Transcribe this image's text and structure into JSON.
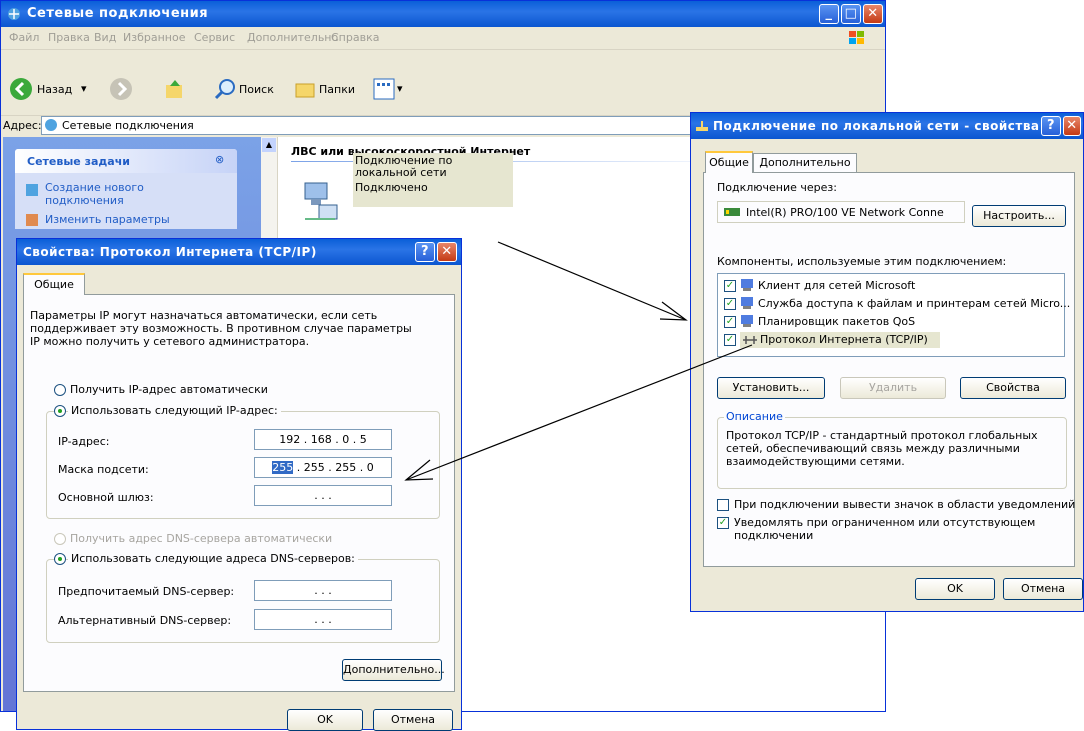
{
  "main": {
    "title": "Сетевые подключения",
    "menu": [
      "Файл",
      "Правка",
      "Вид",
      "Избранное",
      "Сервис",
      "Дополнительно",
      "Справка"
    ],
    "toolbar": {
      "back": "Назад",
      "search": "Поиск",
      "folders": "Папки"
    },
    "address_label": "Адрес:",
    "address_value": "Сетевые подключения",
    "tasks_title": "Сетевые задачи",
    "tasks": [
      "Создание нового подключения",
      "Изменить параметры"
    ],
    "section_title": "ЛВС или высокоскоростной Интернет",
    "connection_name": "Подключение по локальной сети",
    "connection_status": "Подключено"
  },
  "tcpip": {
    "title": "Свойства: Протокол Интернета (TCP/IP)",
    "tab": "Общие",
    "description": [
      "Параметры IP могут назначаться автоматически, если сеть",
      "поддерживает эту возможность. В противном случае параметры",
      "IP можно получить у сетевого администратора."
    ],
    "radio_auto_ip": "Получить IP-адрес автоматически",
    "radio_manual_ip": "Использовать следующий IP-адрес:",
    "ip_label": "IP-адрес:",
    "ip_value": "192 . 168 .  0  .  5",
    "mask_label": "Маска подсети:",
    "mask_first": "255",
    "mask_rest": ". 255 . 255 .  0",
    "gateway_label": "Основной шлюз:",
    "empty_ip": ".      .      .",
    "radio_auto_dns": "Получить адрес DNS-сервера автоматически",
    "radio_manual_dns": "Использовать следующие адреса DNS-серверов:",
    "pref_dns_label": "Предпочитаемый DNS-сервер:",
    "alt_dns_label": "Альтернативный DNS-сервер:",
    "advanced_btn": "Дополнительно...",
    "ok_btn": "OK",
    "cancel_btn": "Отмена"
  },
  "lan": {
    "title": "Подключение по локальной сети - свойства",
    "tabs": [
      "Общие",
      "Дополнительно"
    ],
    "connect_via_label": "Подключение через:",
    "adapter": "Intel(R) PRO/100 VE Network Conne",
    "configure_btn": "Настроить...",
    "components_label": "Компоненты, используемые этим подключением:",
    "components": [
      "Клиент для сетей Microsoft",
      "Служба доступа к файлам и принтерам сетей Micro...",
      "Планировщик пакетов QoS",
      "Протокол Интернета (TCP/IP)"
    ],
    "install_btn": "Установить...",
    "remove_btn": "Удалить",
    "properties_btn": "Свойства",
    "desc_group": "Описание",
    "desc_text": [
      "Протокол TCP/IP - стандартный протокол глобальных",
      "сетей, обеспечивающий связь между различными",
      "взаимодействующими сетями."
    ],
    "show_icon": "При подключении вывести значок в области уведомлений",
    "notify": [
      "Уведомлять при ограниченном или отсутствующем",
      "подключении"
    ],
    "ok_btn": "OK",
    "cancel_btn": "Отмена"
  },
  "colors": {
    "xp_blue": "#0a5fd8",
    "dialog_bg": "#ece9d8",
    "task_pane": "#7ba2e7"
  }
}
